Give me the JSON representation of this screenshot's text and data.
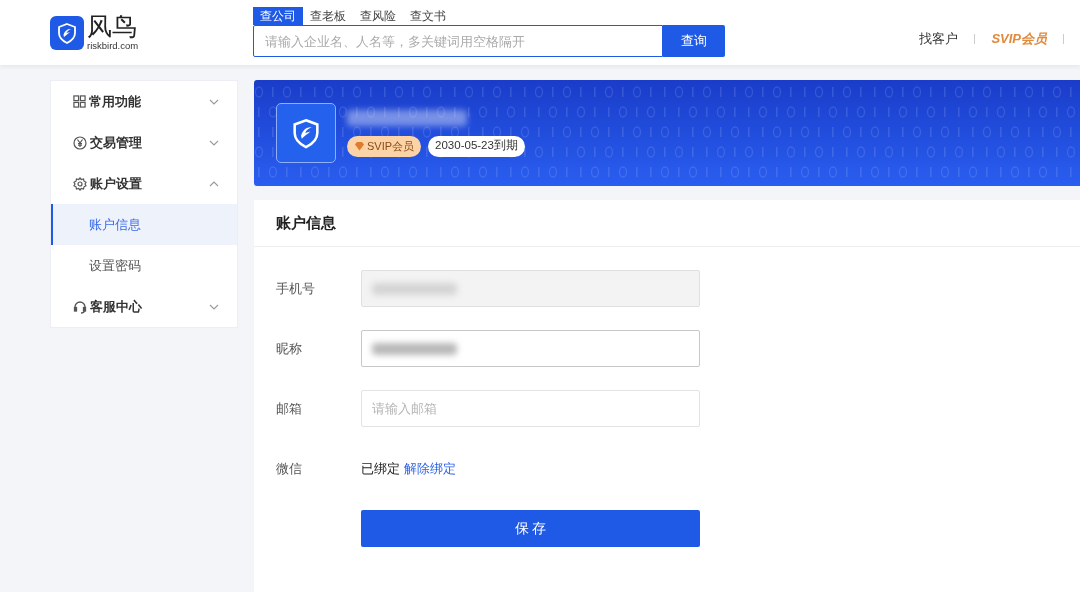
{
  "header": {
    "logo": {
      "name": "风鸟",
      "domain": "riskbird.com"
    },
    "search": {
      "tabs": [
        {
          "label": "查公司",
          "selected": true
        },
        {
          "label": "查老板",
          "selected": false
        },
        {
          "label": "查风险",
          "selected": false
        },
        {
          "label": "查文书",
          "selected": false
        }
      ],
      "placeholder": "请输入企业名、人名等，多关键词用空格隔开",
      "button": "查询"
    },
    "nav_links": [
      {
        "label": "找客户",
        "kind": "plain"
      },
      {
        "label": "SVIP会员",
        "kind": "vip"
      }
    ]
  },
  "sidebar": {
    "items": [
      {
        "label": "常用功能",
        "expanded": false
      },
      {
        "label": "交易管理",
        "expanded": false
      },
      {
        "label": "账户设置",
        "expanded": true,
        "children": [
          {
            "label": "账户信息",
            "selected": true
          },
          {
            "label": "设置密码",
            "selected": false
          }
        ]
      },
      {
        "label": "客服中心",
        "expanded": false
      }
    ]
  },
  "banner": {
    "name_redacted": true,
    "vip_badge": "SVIP会员",
    "expiry": "2030-05-23到期"
  },
  "form": {
    "title": "账户信息",
    "fields": [
      {
        "kind": "input",
        "label": "手机号",
        "disabled": true,
        "redacted": true
      },
      {
        "kind": "input",
        "label": "昵称",
        "disabled": false,
        "redacted": true
      },
      {
        "kind": "input",
        "label": "邮箱",
        "disabled": false,
        "redacted": false,
        "placeholder": "请输入邮箱"
      },
      {
        "kind": "binding",
        "label": "微信",
        "status": "已绑定",
        "link": "解除绑定"
      }
    ],
    "save_button": "保 存"
  }
}
